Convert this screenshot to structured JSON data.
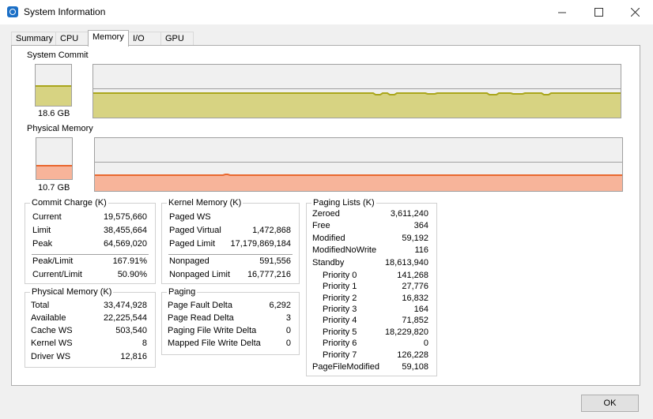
{
  "window": {
    "title": "System Information"
  },
  "tabs": [
    "Summary",
    "CPU",
    "Memory",
    "I/O",
    "GPU"
  ],
  "colors": {
    "commit_fill": "#d7d382",
    "commit_line": "#aaa61c",
    "phys_fill": "#f7b49a",
    "phys_line": "#e9682f"
  },
  "system_commit": {
    "label": "System Commit",
    "value": "18.6 GB",
    "level": 0.48
  },
  "physical_memory": {
    "label": "Physical Memory",
    "value": "10.7 GB",
    "level": 0.32
  },
  "commit_charge": {
    "title": "Commit Charge (K)",
    "rows": [
      {
        "k": "Current",
        "v": "19,575,660"
      },
      {
        "k": "Limit",
        "v": "38,455,664"
      },
      {
        "k": "Peak",
        "v": "64,569,020"
      },
      {
        "k": "Peak/Limit",
        "v": "167.91%"
      },
      {
        "k": "Current/Limit",
        "v": "50.90%"
      }
    ]
  },
  "kernel_memory": {
    "title": "Kernel Memory (K)",
    "rows": [
      {
        "k": "Paged WS",
        "v": ""
      },
      {
        "k": "Paged Virtual",
        "v": "1,472,868"
      },
      {
        "k": "Paged Limit",
        "v": "17,179,869,184"
      },
      {
        "k": "Nonpaged",
        "v": "591,556"
      },
      {
        "k": "Nonpaged Limit",
        "v": "16,777,216"
      }
    ]
  },
  "paging_lists": {
    "title": "Paging Lists (K)",
    "rows": [
      {
        "k": "Zeroed",
        "v": "3,611,240"
      },
      {
        "k": "Free",
        "v": "364"
      },
      {
        "k": "Modified",
        "v": "59,192"
      },
      {
        "k": "ModifiedNoWrite",
        "v": "116"
      },
      {
        "k": "Standby",
        "v": "18,613,940"
      },
      {
        "k": "Priority 0",
        "v": "141,268"
      },
      {
        "k": "Priority 1",
        "v": "27,776"
      },
      {
        "k": "Priority 2",
        "v": "16,832"
      },
      {
        "k": "Priority 3",
        "v": "164"
      },
      {
        "k": "Priority 4",
        "v": "71,852"
      },
      {
        "k": "Priority 5",
        "v": "18,229,820"
      },
      {
        "k": "Priority 6",
        "v": "0"
      },
      {
        "k": "Priority 7",
        "v": "126,228"
      },
      {
        "k": "PageFileModified",
        "v": "59,108"
      }
    ]
  },
  "physical_memory_k": {
    "title": "Physical Memory (K)",
    "rows": [
      {
        "k": "Total",
        "v": "33,474,928"
      },
      {
        "k": "Available",
        "v": "22,225,544"
      },
      {
        "k": "Cache WS",
        "v": "503,540"
      },
      {
        "k": "Kernel WS",
        "v": "8"
      },
      {
        "k": "Driver WS",
        "v": "12,816"
      }
    ]
  },
  "paging": {
    "title": "Paging",
    "rows": [
      {
        "k": "Page Fault Delta",
        "v": "6,292"
      },
      {
        "k": "Page Read Delta",
        "v": "3"
      },
      {
        "k": "Paging File Write Delta",
        "v": "0"
      },
      {
        "k": "Mapped File Write Delta",
        "v": "0"
      }
    ]
  },
  "ok_label": "OK"
}
